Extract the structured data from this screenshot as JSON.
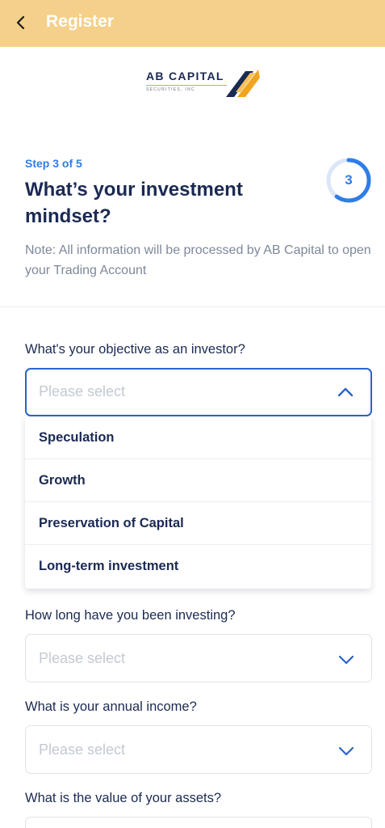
{
  "header": {
    "title": "Register",
    "back_icon": "chevron-left-icon"
  },
  "logo": {
    "name": "AB CAPITAL",
    "subtitle": "SECURITIES, INC"
  },
  "step": {
    "label": "Step 3 of 5",
    "current": "3",
    "fraction": 0.6
  },
  "title": "What’s your investment mindset?",
  "note": "Note: All information will be processed by AB Capital to open your Trading Account",
  "questions": [
    {
      "label": "What's your objective as an investor?",
      "placeholder": "Please select",
      "open": true,
      "options": [
        "Speculation",
        "Growth",
        "Preservation of Capital",
        "Long-term investment"
      ]
    },
    {
      "label": "How long have you been investing?",
      "placeholder": "Please select",
      "open": false
    },
    {
      "label": "What is your annual income?",
      "placeholder": "Please select",
      "open": false
    },
    {
      "label": "What is the value of your assets?",
      "placeholder": "",
      "open": false
    }
  ],
  "colors": {
    "header_bg": "#f5d08a",
    "accent": "#2f7de8",
    "text": "#1b2a52",
    "logo_gold": "#f0a520"
  }
}
